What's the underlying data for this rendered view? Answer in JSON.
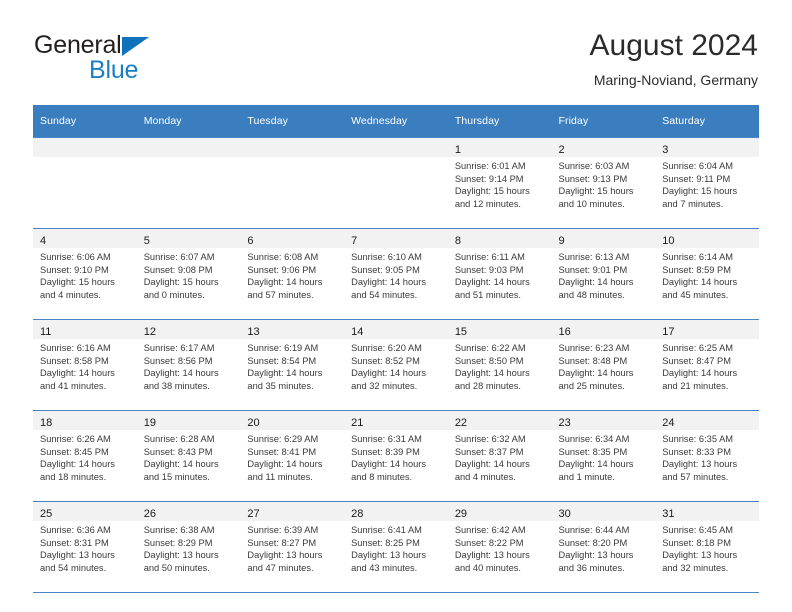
{
  "brand": {
    "line1": "General",
    "line2": "Blue",
    "triangle_color": "#1072bb",
    "line2_color": "#1b7fc4"
  },
  "header": {
    "title": "August 2024",
    "subtitle": "Maring-Noviand, Germany"
  },
  "theme": {
    "header_bg": "#3b7ec0",
    "header_text": "#ffffff",
    "row_line": "#4a86c5",
    "daynum_band": "#f2f2f2"
  },
  "calendar": {
    "weekday_headers": [
      "Sunday",
      "Monday",
      "Tuesday",
      "Wednesday",
      "Thursday",
      "Friday",
      "Saturday"
    ],
    "labels": {
      "sunrise": "Sunrise:",
      "sunset": "Sunset:",
      "daylight": "Daylight:"
    },
    "weeks": [
      [
        {
          "day": "",
          "sunrise": "",
          "sunset": "",
          "daylight_line1": "",
          "daylight_line2": ""
        },
        {
          "day": "",
          "sunrise": "",
          "sunset": "",
          "daylight_line1": "",
          "daylight_line2": ""
        },
        {
          "day": "",
          "sunrise": "",
          "sunset": "",
          "daylight_line1": "",
          "daylight_line2": ""
        },
        {
          "day": "",
          "sunrise": "",
          "sunset": "",
          "daylight_line1": "",
          "daylight_line2": ""
        },
        {
          "day": "1",
          "sunrise": "Sunrise: 6:01 AM",
          "sunset": "Sunset: 9:14 PM",
          "daylight_line1": "Daylight: 15 hours",
          "daylight_line2": "and 12 minutes."
        },
        {
          "day": "2",
          "sunrise": "Sunrise: 6:03 AM",
          "sunset": "Sunset: 9:13 PM",
          "daylight_line1": "Daylight: 15 hours",
          "daylight_line2": "and 10 minutes."
        },
        {
          "day": "3",
          "sunrise": "Sunrise: 6:04 AM",
          "sunset": "Sunset: 9:11 PM",
          "daylight_line1": "Daylight: 15 hours",
          "daylight_line2": "and 7 minutes."
        }
      ],
      [
        {
          "day": "4",
          "sunrise": "Sunrise: 6:06 AM",
          "sunset": "Sunset: 9:10 PM",
          "daylight_line1": "Daylight: 15 hours",
          "daylight_line2": "and 4 minutes."
        },
        {
          "day": "5",
          "sunrise": "Sunrise: 6:07 AM",
          "sunset": "Sunset: 9:08 PM",
          "daylight_line1": "Daylight: 15 hours",
          "daylight_line2": "and 0 minutes."
        },
        {
          "day": "6",
          "sunrise": "Sunrise: 6:08 AM",
          "sunset": "Sunset: 9:06 PM",
          "daylight_line1": "Daylight: 14 hours",
          "daylight_line2": "and 57 minutes."
        },
        {
          "day": "7",
          "sunrise": "Sunrise: 6:10 AM",
          "sunset": "Sunset: 9:05 PM",
          "daylight_line1": "Daylight: 14 hours",
          "daylight_line2": "and 54 minutes."
        },
        {
          "day": "8",
          "sunrise": "Sunrise: 6:11 AM",
          "sunset": "Sunset: 9:03 PM",
          "daylight_line1": "Daylight: 14 hours",
          "daylight_line2": "and 51 minutes."
        },
        {
          "day": "9",
          "sunrise": "Sunrise: 6:13 AM",
          "sunset": "Sunset: 9:01 PM",
          "daylight_line1": "Daylight: 14 hours",
          "daylight_line2": "and 48 minutes."
        },
        {
          "day": "10",
          "sunrise": "Sunrise: 6:14 AM",
          "sunset": "Sunset: 8:59 PM",
          "daylight_line1": "Daylight: 14 hours",
          "daylight_line2": "and 45 minutes."
        }
      ],
      [
        {
          "day": "11",
          "sunrise": "Sunrise: 6:16 AM",
          "sunset": "Sunset: 8:58 PM",
          "daylight_line1": "Daylight: 14 hours",
          "daylight_line2": "and 41 minutes."
        },
        {
          "day": "12",
          "sunrise": "Sunrise: 6:17 AM",
          "sunset": "Sunset: 8:56 PM",
          "daylight_line1": "Daylight: 14 hours",
          "daylight_line2": "and 38 minutes."
        },
        {
          "day": "13",
          "sunrise": "Sunrise: 6:19 AM",
          "sunset": "Sunset: 8:54 PM",
          "daylight_line1": "Daylight: 14 hours",
          "daylight_line2": "and 35 minutes."
        },
        {
          "day": "14",
          "sunrise": "Sunrise: 6:20 AM",
          "sunset": "Sunset: 8:52 PM",
          "daylight_line1": "Daylight: 14 hours",
          "daylight_line2": "and 32 minutes."
        },
        {
          "day": "15",
          "sunrise": "Sunrise: 6:22 AM",
          "sunset": "Sunset: 8:50 PM",
          "daylight_line1": "Daylight: 14 hours",
          "daylight_line2": "and 28 minutes."
        },
        {
          "day": "16",
          "sunrise": "Sunrise: 6:23 AM",
          "sunset": "Sunset: 8:48 PM",
          "daylight_line1": "Daylight: 14 hours",
          "daylight_line2": "and 25 minutes."
        },
        {
          "day": "17",
          "sunrise": "Sunrise: 6:25 AM",
          "sunset": "Sunset: 8:47 PM",
          "daylight_line1": "Daylight: 14 hours",
          "daylight_line2": "and 21 minutes."
        }
      ],
      [
        {
          "day": "18",
          "sunrise": "Sunrise: 6:26 AM",
          "sunset": "Sunset: 8:45 PM",
          "daylight_line1": "Daylight: 14 hours",
          "daylight_line2": "and 18 minutes."
        },
        {
          "day": "19",
          "sunrise": "Sunrise: 6:28 AM",
          "sunset": "Sunset: 8:43 PM",
          "daylight_line1": "Daylight: 14 hours",
          "daylight_line2": "and 15 minutes."
        },
        {
          "day": "20",
          "sunrise": "Sunrise: 6:29 AM",
          "sunset": "Sunset: 8:41 PM",
          "daylight_line1": "Daylight: 14 hours",
          "daylight_line2": "and 11 minutes."
        },
        {
          "day": "21",
          "sunrise": "Sunrise: 6:31 AM",
          "sunset": "Sunset: 8:39 PM",
          "daylight_line1": "Daylight: 14 hours",
          "daylight_line2": "and 8 minutes."
        },
        {
          "day": "22",
          "sunrise": "Sunrise: 6:32 AM",
          "sunset": "Sunset: 8:37 PM",
          "daylight_line1": "Daylight: 14 hours",
          "daylight_line2": "and 4 minutes."
        },
        {
          "day": "23",
          "sunrise": "Sunrise: 6:34 AM",
          "sunset": "Sunset: 8:35 PM",
          "daylight_line1": "Daylight: 14 hours",
          "daylight_line2": "and 1 minute."
        },
        {
          "day": "24",
          "sunrise": "Sunrise: 6:35 AM",
          "sunset": "Sunset: 8:33 PM",
          "daylight_line1": "Daylight: 13 hours",
          "daylight_line2": "and 57 minutes."
        }
      ],
      [
        {
          "day": "25",
          "sunrise": "Sunrise: 6:36 AM",
          "sunset": "Sunset: 8:31 PM",
          "daylight_line1": "Daylight: 13 hours",
          "daylight_line2": "and 54 minutes."
        },
        {
          "day": "26",
          "sunrise": "Sunrise: 6:38 AM",
          "sunset": "Sunset: 8:29 PM",
          "daylight_line1": "Daylight: 13 hours",
          "daylight_line2": "and 50 minutes."
        },
        {
          "day": "27",
          "sunrise": "Sunrise: 6:39 AM",
          "sunset": "Sunset: 8:27 PM",
          "daylight_line1": "Daylight: 13 hours",
          "daylight_line2": "and 47 minutes."
        },
        {
          "day": "28",
          "sunrise": "Sunrise: 6:41 AM",
          "sunset": "Sunset: 8:25 PM",
          "daylight_line1": "Daylight: 13 hours",
          "daylight_line2": "and 43 minutes."
        },
        {
          "day": "29",
          "sunrise": "Sunrise: 6:42 AM",
          "sunset": "Sunset: 8:22 PM",
          "daylight_line1": "Daylight: 13 hours",
          "daylight_line2": "and 40 minutes."
        },
        {
          "day": "30",
          "sunrise": "Sunrise: 6:44 AM",
          "sunset": "Sunset: 8:20 PM",
          "daylight_line1": "Daylight: 13 hours",
          "daylight_line2": "and 36 minutes."
        },
        {
          "day": "31",
          "sunrise": "Sunrise: 6:45 AM",
          "sunset": "Sunset: 8:18 PM",
          "daylight_line1": "Daylight: 13 hours",
          "daylight_line2": "and 32 minutes."
        }
      ]
    ]
  }
}
